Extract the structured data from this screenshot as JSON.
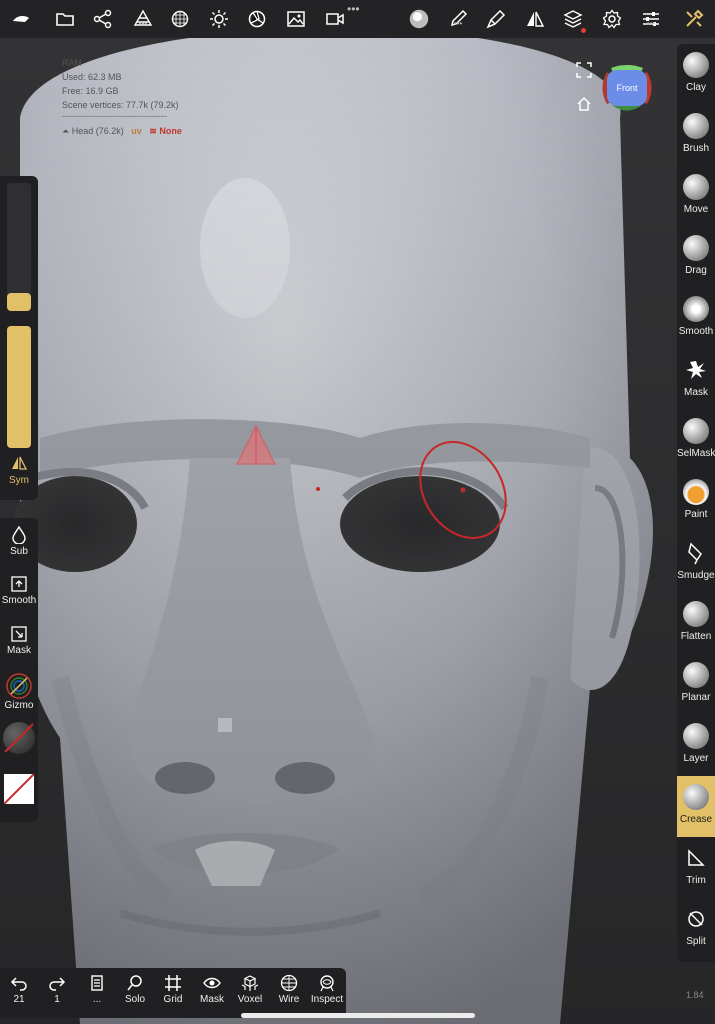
{
  "top_toolbar": {
    "icons": [
      "nomad-logo-icon",
      "folder-icon",
      "scene-graph-icon",
      "primitives-icon",
      "topology-icon",
      "lighting-icon",
      "shading-icon",
      "background-icon",
      "camera-icon",
      "material-icon",
      "paint-icon",
      "stroke-icon",
      "symmetry-icon",
      "layers-icon",
      "settings-icon",
      "interface-icon",
      "tools-icon"
    ],
    "dots_label": "•••"
  },
  "info": {
    "ram_label": "RAM",
    "used": "Used: 62.3 MB",
    "free": "Free: 16.9 GB",
    "scene_vertices": "Scene vertices: 77.7k (79.2k)",
    "separator": "-----------------------------------",
    "mesh_name": "Head (76.2k)",
    "uv_label": "uv",
    "layer_label": "None"
  },
  "view_cube": {
    "label": "Front"
  },
  "left_slider": {
    "radius_level": 0.14,
    "intensity_level": 1.0,
    "sym_label": "Sym"
  },
  "left_tools": [
    {
      "name": "sub",
      "label": "Sub"
    },
    {
      "name": "smooth",
      "label": "Smooth"
    },
    {
      "name": "mask",
      "label": "Mask"
    },
    {
      "name": "gizmo",
      "label": "Gizmo"
    }
  ],
  "right_tools": [
    {
      "label": "Clay"
    },
    {
      "label": "Brush"
    },
    {
      "label": "Move"
    },
    {
      "label": "Drag"
    },
    {
      "label": "Smooth"
    },
    {
      "label": "Mask"
    },
    {
      "label": "SelMask"
    },
    {
      "label": "Paint"
    },
    {
      "label": "Smudge"
    },
    {
      "label": "Flatten"
    },
    {
      "label": "Planar"
    },
    {
      "label": "Layer"
    },
    {
      "label": "Crease"
    },
    {
      "label": "Trim"
    },
    {
      "label": "Split"
    }
  ],
  "active_tool": "Crease",
  "bottom_toolbar": {
    "undo_count": "21",
    "redo_count": "1",
    "items": [
      "Solo",
      "Grid",
      "Mask",
      "Voxel",
      "Wire",
      "Inspect"
    ],
    "more_label": "..."
  },
  "version": "1.84",
  "colors": {
    "accent": "#e2c067",
    "panel": "#202022",
    "brush_cursor": "#c62828"
  }
}
